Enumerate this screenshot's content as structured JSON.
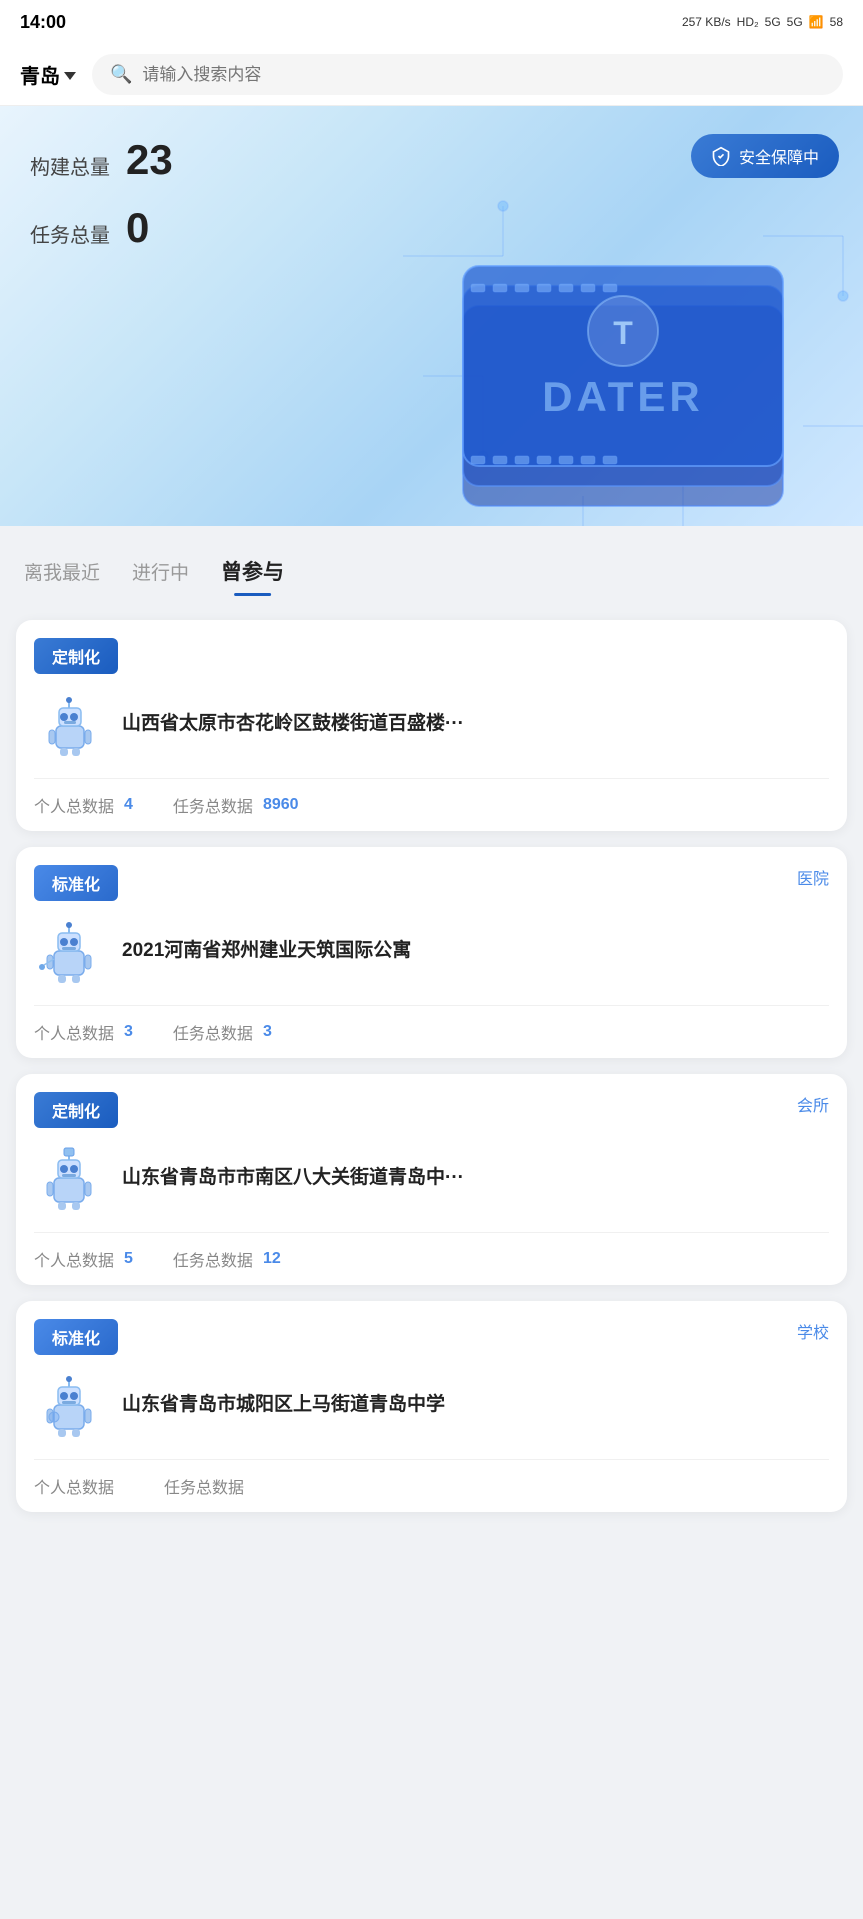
{
  "statusBar": {
    "time": "14:00",
    "speed": "257 KB/s",
    "network1": "HD₂",
    "network2": "5G",
    "network3": "5G",
    "battery": "58"
  },
  "topNav": {
    "city": "青岛",
    "searchPlaceholder": "请输入搜索内容"
  },
  "hero": {
    "buildTotalLabel": "构建总量",
    "buildTotalValue": "23",
    "taskTotalLabel": "任务总量",
    "taskTotalValue": "0",
    "safetyBadge": "安全保障中",
    "chipText": "DATER"
  },
  "filterTabs": {
    "tabs": [
      {
        "label": "离我最近",
        "active": false
      },
      {
        "label": "进行中",
        "active": false
      },
      {
        "label": "曾参与",
        "active": true
      }
    ]
  },
  "cards": [
    {
      "badgeText": "定制化",
      "badgeType": "custom",
      "typeLabel": "",
      "title": "山西省太原市杏花岭区鼓楼街道百盛楼···",
      "personalDataLabel": "个人总数据",
      "personalDataValue": "4",
      "taskDataLabel": "任务总数据",
      "taskDataValue": "8960"
    },
    {
      "badgeText": "标准化",
      "badgeType": "standard",
      "typeLabel": "医院",
      "title": "2021河南省郑州建业天筑国际公寓",
      "personalDataLabel": "个人总数据",
      "personalDataValue": "3",
      "taskDataLabel": "任务总数据",
      "taskDataValue": "3"
    },
    {
      "badgeText": "定制化",
      "badgeType": "custom",
      "typeLabel": "会所",
      "title": "山东省青岛市市南区八大关街道青岛中···",
      "personalDataLabel": "个人总数据",
      "personalDataValue": "5",
      "taskDataLabel": "任务总数据",
      "taskDataValue": "12"
    },
    {
      "badgeText": "标准化",
      "badgeType": "standard",
      "typeLabel": "学校",
      "title": "山东省青岛市城阳区上马街道青岛中学",
      "personalDataLabel": "个人总数据",
      "personalDataValue": "",
      "taskDataLabel": "任务总数据",
      "taskDataValue": ""
    }
  ]
}
